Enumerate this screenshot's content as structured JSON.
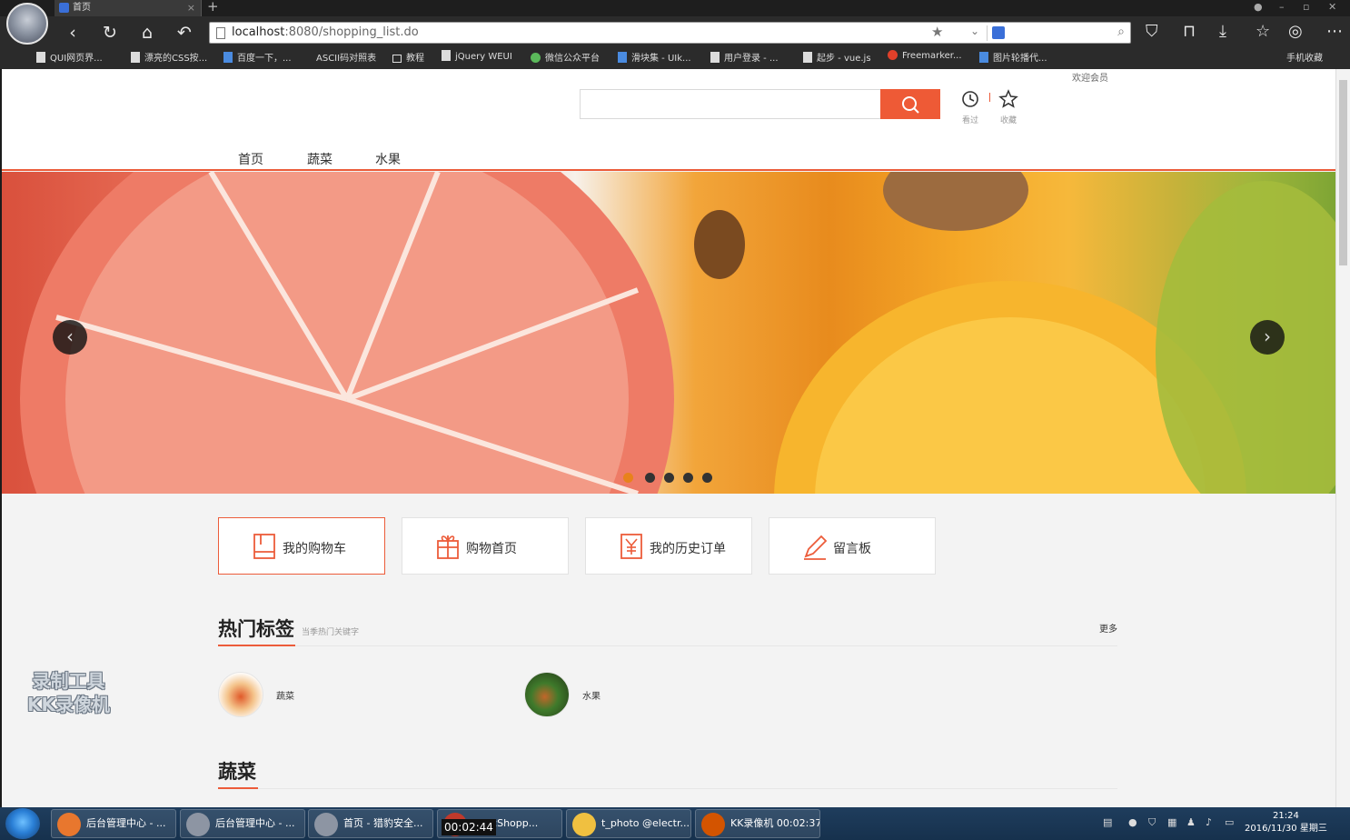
{
  "browser": {
    "tab_title": "首页",
    "tab_close": "×",
    "new_tab": "+",
    "url_host": "localhost",
    "url_rest": ":8080/shopping_list.do",
    "bookmarks": [
      {
        "label": "QUI网页界...",
        "icon": "page"
      },
      {
        "label": "漂亮的CSS按...",
        "icon": "page"
      },
      {
        "label": "百度一下，...",
        "icon": "blue"
      },
      {
        "label": "ASCII码对照表",
        "icon": "none"
      },
      {
        "label": "教程",
        "icon": "folder"
      },
      {
        "label": "jQuery WEUI",
        "icon": "page"
      },
      {
        "label": "微信公众平台",
        "icon": "green"
      },
      {
        "label": "滑块集 - UIk...",
        "icon": "blue"
      },
      {
        "label": "用户登录 - ...",
        "icon": "page"
      },
      {
        "label": "起步 - vue.js",
        "icon": "page"
      },
      {
        "label": "Freemarker...",
        "icon": "red"
      },
      {
        "label": "图片轮播代...",
        "icon": "blue"
      }
    ],
    "mobile_fav": "手机收藏"
  },
  "header": {
    "welcome": "欢迎会员",
    "search_placeholder": "",
    "history_label": "看过",
    "favorites_label": "收藏"
  },
  "nav": {
    "items": [
      "首页",
      "蔬菜",
      "水果"
    ]
  },
  "banner": {
    "slide_count": 5,
    "active_slide": 1,
    "prev": "‹",
    "next": "›"
  },
  "quick_links": [
    {
      "label": "我的购物车",
      "icon": "cart-icon"
    },
    {
      "label": "购物首页",
      "icon": "gift-icon"
    },
    {
      "label": "我的历史订单",
      "icon": "order-icon"
    },
    {
      "label": "留言板",
      "icon": "pencil-icon"
    }
  ],
  "hot_tags": {
    "title": "热门标签",
    "subtitle": "当季热门关键字",
    "more": "更多",
    "tags": [
      {
        "label": "蔬菜"
      },
      {
        "label": "水果"
      }
    ]
  },
  "vegetables_section": {
    "title": "蔬菜"
  },
  "watermark": {
    "line1": "录制工具",
    "line2": "KK录像机"
  },
  "taskbar": {
    "items": [
      {
        "label": "后台管理中心 - ..."
      },
      {
        "label": "后台管理中心 - ..."
      },
      {
        "label": "首页 - 猎豹安全..."
      },
      {
        "label": "ronicShopp..."
      },
      {
        "label": "t_photo @electr..."
      },
      {
        "label": "KK录像机 00:02:37"
      }
    ],
    "timer": "00:02:44",
    "time": "21:24",
    "date": "2016/11/30 星期三"
  }
}
